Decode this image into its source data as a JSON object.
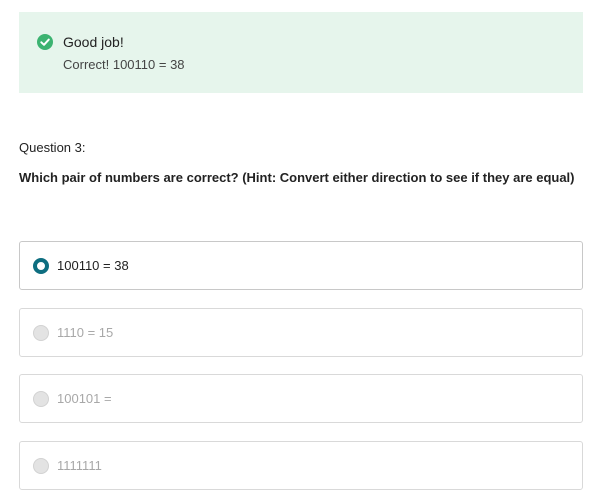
{
  "feedback": {
    "title": "Good job!",
    "message": "Correct! 100110 = 38",
    "icon": "check-circle-icon",
    "accent_color": "#3cb371",
    "background_color": "#e6f5ec"
  },
  "question": {
    "number_label": "Question 3:",
    "text": "Which pair of numbers are correct? (Hint: Convert either direction to see if they are equal)"
  },
  "options": [
    {
      "label": "100110 = 38",
      "selected": true,
      "disabled": false
    },
    {
      "label": "1110 = 15",
      "selected": false,
      "disabled": true
    },
    {
      "label": "100101 =",
      "selected": false,
      "disabled": true
    },
    {
      "label": "1111111",
      "selected": false,
      "disabled": true
    }
  ],
  "colors": {
    "selected_radio": "#0e6e80",
    "disabled_text": "#a8a8a8",
    "border": "#d9d9d9"
  }
}
